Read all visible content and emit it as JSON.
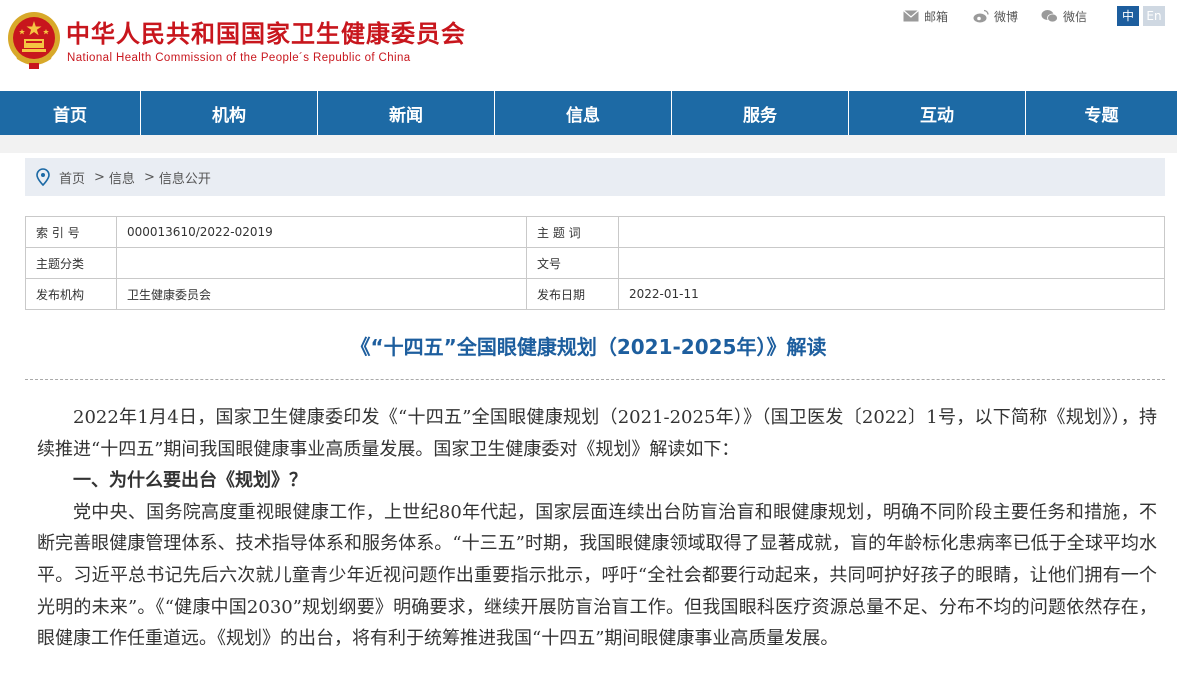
{
  "header": {
    "name_cn": "中华人民共和国国家卫生健康委员会",
    "name_en": "National Health Commission of the People´s Republic of China",
    "share": {
      "mail": "邮箱",
      "weibo": "微博",
      "wechat": "微信"
    },
    "lang": {
      "zh": "中",
      "en": "En"
    }
  },
  "nav": [
    "首页",
    "机构",
    "新闻",
    "信息",
    "服务",
    "互动",
    "专题"
  ],
  "breadcrumb": {
    "home": "首页",
    "level2": "信息",
    "level3": "信息公开",
    "sep": ">"
  },
  "meta": {
    "index_label": "索 引 号",
    "index_value": "000013610/2022-02019",
    "topic_word_label": "主 题 词",
    "topic_word_value": "",
    "category_label": "主题分类",
    "category_value": "",
    "doc_no_label": "文号",
    "doc_no_value": "",
    "publisher_label": "发布机构",
    "publisher_value": "卫生健康委员会",
    "date_label": "发布日期",
    "date_value": "2022-01-11"
  },
  "article": {
    "title": "《“十四五”全国眼健康规划（2021-2025年）》解读",
    "intro": "2022年1月4日，国家卫生健康委印发《“十四五”全国眼健康规划（2021-2025年）》（国卫医发〔2022〕1号，以下简称《规划》），持续推进“十四五”期间我国眼健康事业高质量发展。国家卫生健康委对《规划》解读如下：",
    "heading1": "一、为什么要出台《规划》？",
    "para1": "党中央、国务院高度重视眼健康工作，上世纪80年代起，国家层面连续出台防盲治盲和眼健康规划，明确不同阶段主要任务和措施，不断完善眼健康管理体系、技术指导体系和服务体系。“十三五”时期，我国眼健康领域取得了显著成就，盲的年龄标化患病率已低于全球平均水平。习近平总书记先后六次就儿童青少年近视问题作出重要指示批示，呼吁“全社会都要行动起来，共同呵护好孩子的眼睛，让他们拥有一个光明的未来”。《“健康中国2030”规划纲要》明确要求，继续开展防盲治盲工作。但我国眼科医疗资源总量不足、分布不均的问题依然存在，眼健康工作任重道远。《规划》的出台，将有利于统筹推进我国“十四五”期间眼健康事业高质量发展。"
  },
  "colors": {
    "brand_red": "#c8161d",
    "nav_blue": "#1d6aa5",
    "title_blue": "#1d5e9e"
  }
}
